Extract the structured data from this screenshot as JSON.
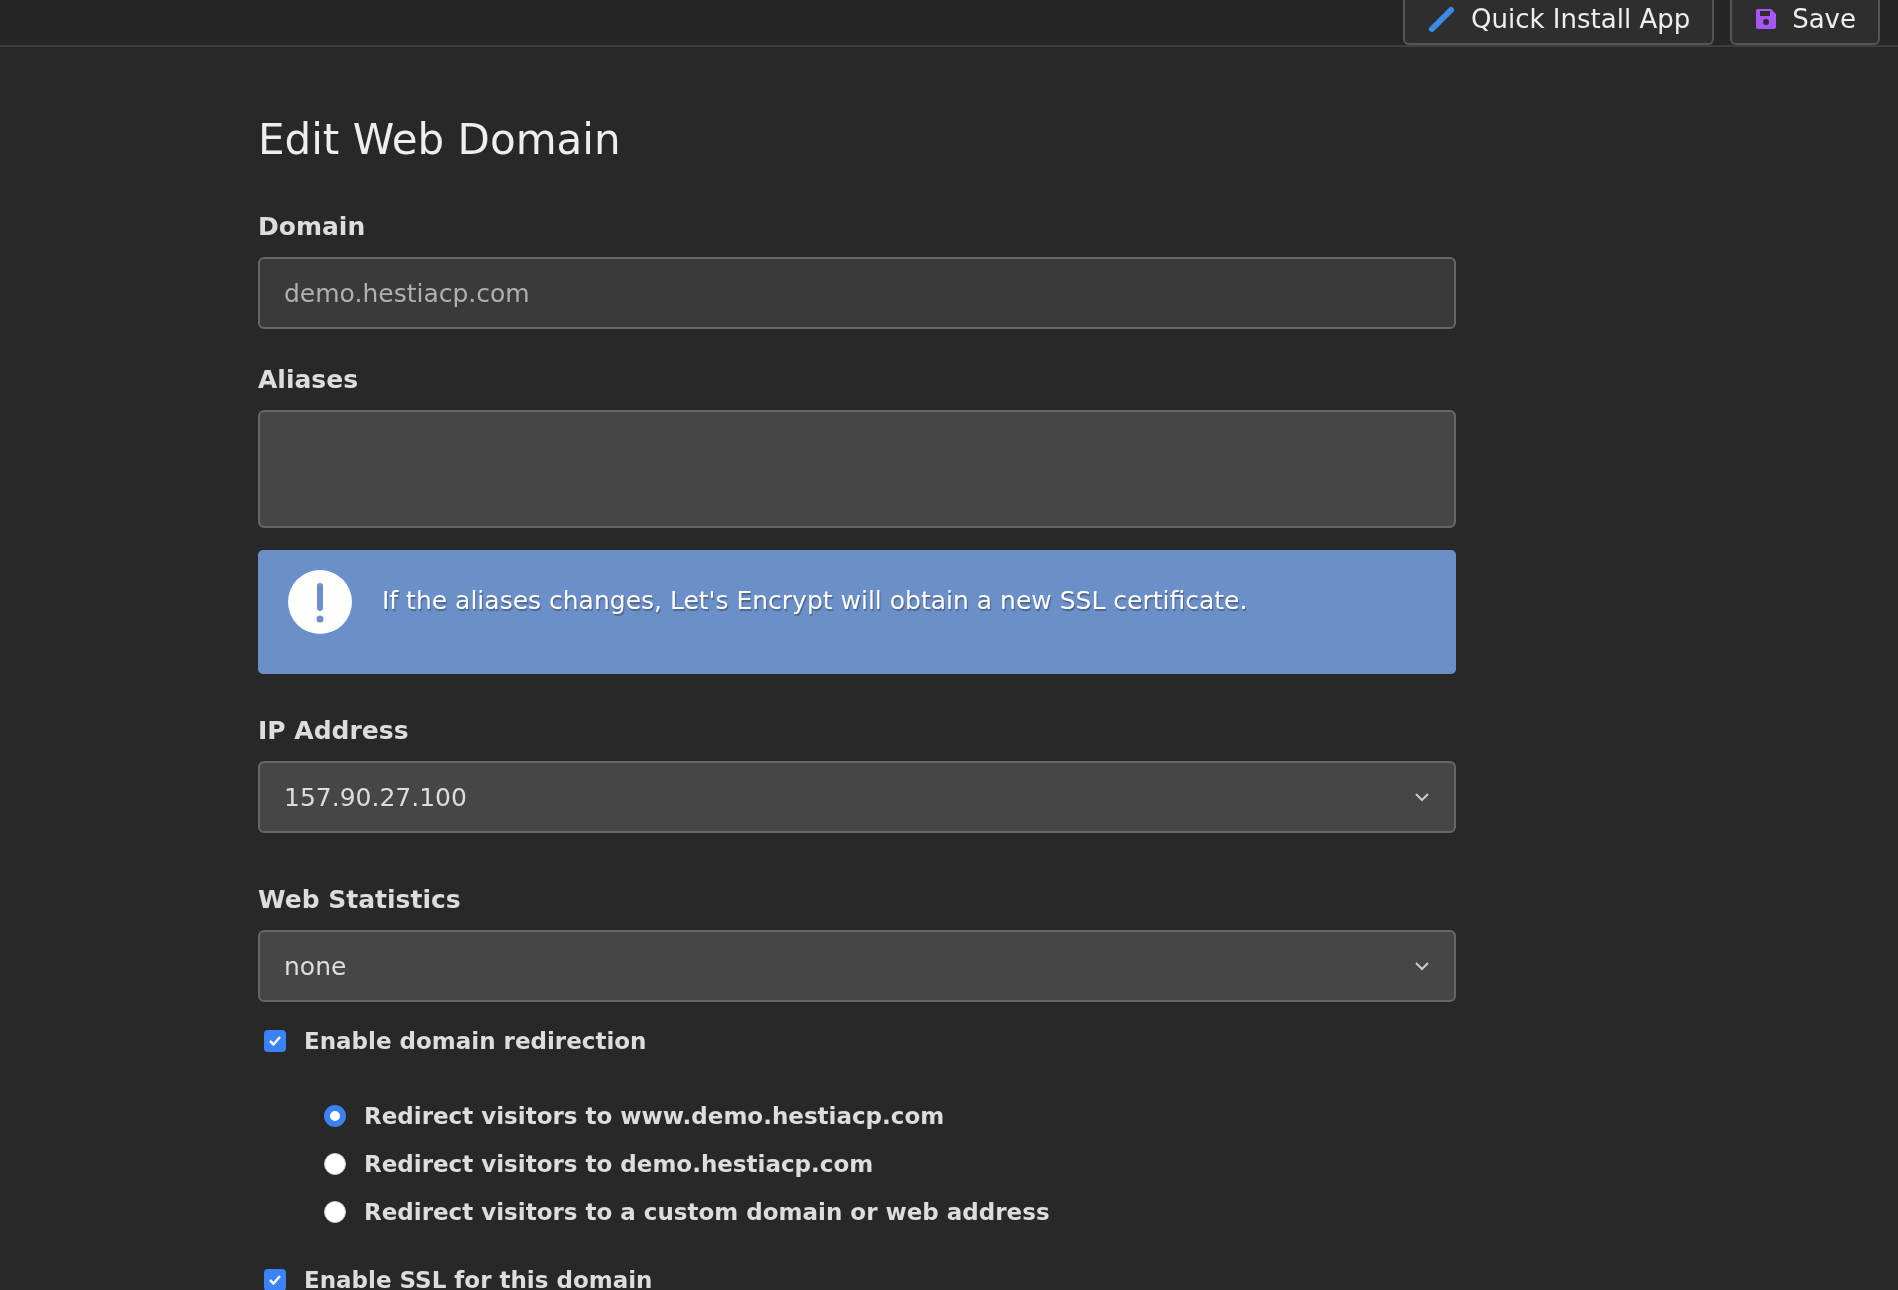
{
  "toolbar": {
    "buttons": [
      {
        "kind": "install",
        "label": "Quick Install App"
      },
      {
        "kind": "save",
        "label": "Save"
      }
    ]
  },
  "title": "Edit Web Domain",
  "domain": {
    "label": "Domain",
    "value": "demo.hestiacp.com"
  },
  "aliases": {
    "label": "Aliases"
  },
  "alert": {
    "text": "If the aliases changes, Let's Encrypt will obtain a new SSL certificate."
  },
  "ip_address": {
    "label": "IP Address",
    "value": "157.90.27.100"
  },
  "web_statistics": {
    "label": "Web Statistics",
    "value": "none"
  },
  "redirection": {
    "label": "Enable domain redirection",
    "checked": true,
    "options": [
      {
        "label": "Redirect visitors to www.demo.hestiacp.com",
        "selected": true
      },
      {
        "label": "Redirect visitors to demo.hestiacp.com",
        "selected": false
      },
      {
        "label": "Redirect visitors to a custom domain or web address",
        "selected": false
      }
    ]
  },
  "ssl": {
    "label": "Enable SSL for this domain",
    "checked": true
  }
}
